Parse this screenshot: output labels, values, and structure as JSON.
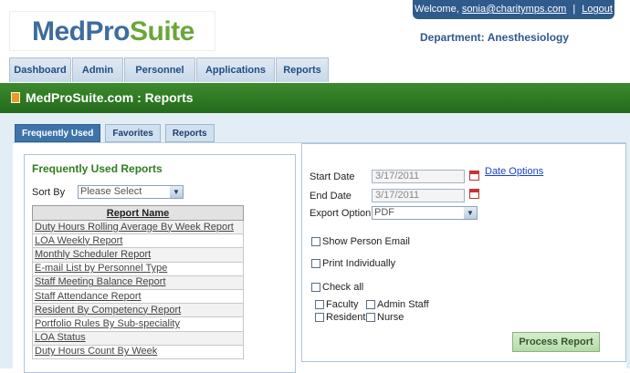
{
  "header": {
    "logo": {
      "part1": "MedPro",
      "part2": "Suite"
    },
    "welcome": {
      "text": "Welcome,",
      "email": "sonia@charitymps.com",
      "separator": "|",
      "logout": "Logout"
    },
    "department": {
      "label": "Department:",
      "name": "Anesthesiology"
    }
  },
  "nav": [
    {
      "label": "Dashboard"
    },
    {
      "label": "Admin"
    },
    {
      "label": "Personnel"
    },
    {
      "label": "Applications"
    },
    {
      "label": "Reports"
    }
  ],
  "banner": {
    "title": "MedProSuite.com : Reports",
    "icon": "book-icon"
  },
  "tabs": [
    {
      "label": "Frequently Used",
      "active": true
    },
    {
      "label": "Favorites",
      "active": false
    },
    {
      "label": "Reports",
      "active": false
    }
  ],
  "left": {
    "title": "Frequently Used Reports",
    "sort_label": "Sort By",
    "sort_value": "Please Select",
    "table_header": "Report Name",
    "reports": [
      "Duty Hours Rolling Average By Week Report",
      "LOA Weekly Report",
      "Monthly Scheduler Report",
      "E-mail List by Personnel Type",
      "Staff Meeting Balance Report",
      "Staff Attendance Report",
      "Resident By Competency Report",
      "Portfolio Rules By Sub-speciality",
      "LOA Status",
      "Duty Hours Count By Week"
    ]
  },
  "right": {
    "start_date_label": "Start Date",
    "start_date_value": "3/17/2011",
    "end_date_label": "End Date",
    "end_date_value": "3/17/2011",
    "date_options": "Date Options",
    "export_label": "Export Option",
    "export_value": "PDF",
    "show_email": "Show Person Email",
    "print_individually": "Print Individually",
    "check_all": "Check all",
    "faculty": "Faculty",
    "admin_staff": "Admin Staff",
    "resident": "Resident",
    "nurse": "Nurse",
    "process_button": "Process Report"
  },
  "colors": {
    "brand_blue": "#2f5a8c",
    "brand_green": "#2f7d1f",
    "banner_green": "#3c8a2e",
    "tab_active": "#3f74aa",
    "link_blue": "#1a3fd0"
  }
}
